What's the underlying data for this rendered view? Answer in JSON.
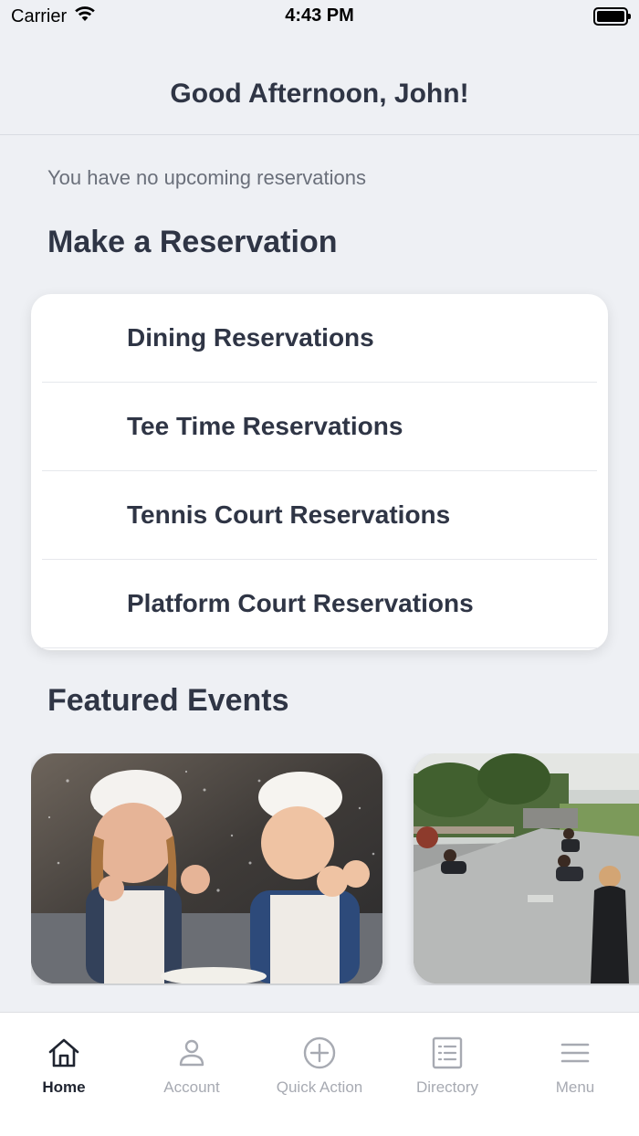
{
  "status_bar": {
    "carrier": "Carrier",
    "time": "4:43 PM"
  },
  "header": {
    "greeting": "Good Afternoon, John!"
  },
  "reservations": {
    "empty_message": "You have no upcoming reservations",
    "section_title": "Make a Reservation",
    "items": [
      {
        "label": "Dining Reservations"
      },
      {
        "label": "Tee Time Reservations"
      },
      {
        "label": "Tennis Court Reservations"
      },
      {
        "label": "Platform Court Reservations"
      }
    ]
  },
  "featured": {
    "section_title": "Featured Events"
  },
  "tab_bar": {
    "tabs": [
      {
        "label": "Home",
        "icon": "home-icon",
        "active": true
      },
      {
        "label": "Account",
        "icon": "account-icon",
        "active": false
      },
      {
        "label": "Quick Action",
        "icon": "plus-circle-icon",
        "active": false
      },
      {
        "label": "Directory",
        "icon": "directory-icon",
        "active": false
      },
      {
        "label": "Menu",
        "icon": "hamburger-menu-icon",
        "active": false
      }
    ]
  }
}
